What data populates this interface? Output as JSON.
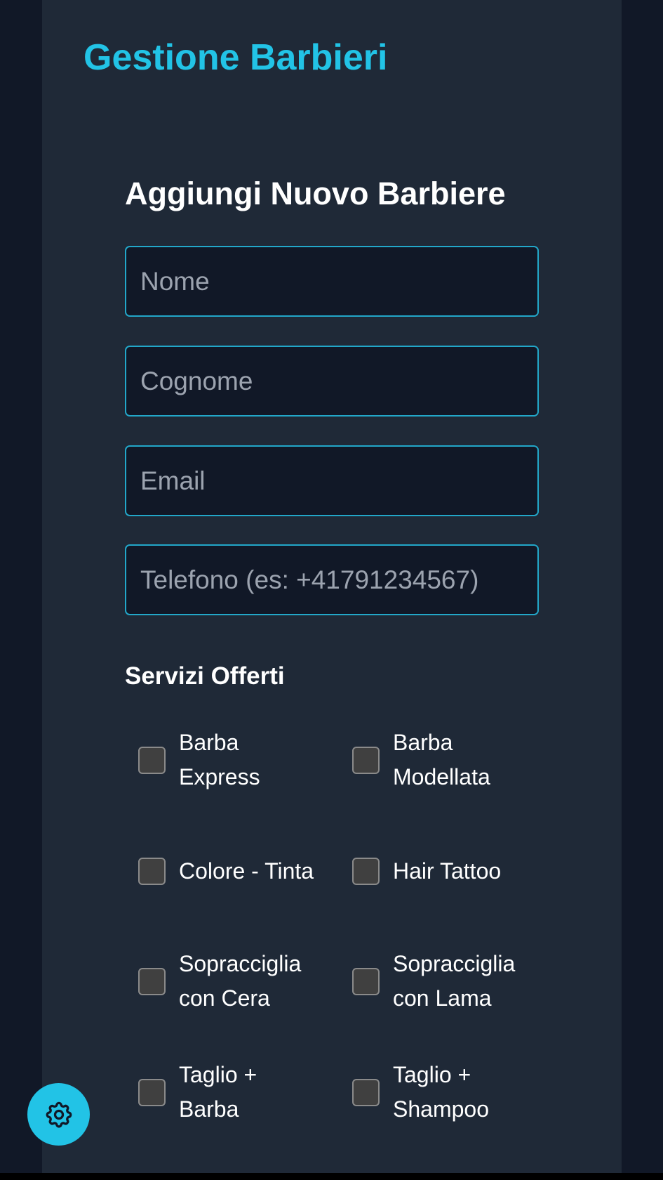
{
  "header": {
    "title": "Gestione Barbieri"
  },
  "form": {
    "title": "Aggiungi Nuovo Barbiere",
    "fields": {
      "nome": {
        "placeholder": "Nome",
        "value": ""
      },
      "cognome": {
        "placeholder": "Cognome",
        "value": ""
      },
      "email": {
        "placeholder": "Email",
        "value": ""
      },
      "telefono": {
        "placeholder": "Telefono (es: +41791234567)",
        "value": ""
      }
    },
    "services_title": "Servizi Offerti",
    "services": [
      {
        "label": "Barba Express",
        "checked": false
      },
      {
        "label": "Barba Modellata",
        "checked": false
      },
      {
        "label": "Colore - Tinta",
        "checked": false
      },
      {
        "label": "Hair Tattoo",
        "checked": false
      },
      {
        "label": "Sopracciglia con Cera",
        "checked": false
      },
      {
        "label": "Sopracciglia con Lama",
        "checked": false
      },
      {
        "label": "Taglio + Barba",
        "checked": false
      },
      {
        "label": "Taglio + Shampoo",
        "checked": false
      }
    ]
  },
  "fab": {
    "icon": "gear-icon"
  },
  "colors": {
    "accent": "#22c3e6",
    "page_bg": "#111827",
    "panel_bg": "#1f2937",
    "input_border": "#22a7c9",
    "checkbox_bg": "#404040"
  }
}
